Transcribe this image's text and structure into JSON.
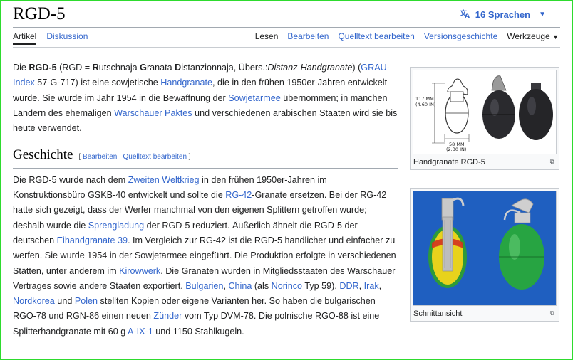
{
  "page": {
    "title": "RGD-5",
    "languages_label": "16 Sprachen",
    "tabs_left": [
      "Artikel",
      "Diskussion"
    ],
    "tabs_right": [
      "Lesen",
      "Bearbeiten",
      "Quelltext bearbeiten",
      "Versionsgeschichte",
      "Werkzeuge"
    ]
  },
  "intro": [
    {
      "t": "Die "
    },
    {
      "t": "RGD-5",
      "b": 1
    },
    {
      "t": " (RGD = "
    },
    {
      "t": "R",
      "b": 1
    },
    {
      "t": "utschnaja "
    },
    {
      "t": "G",
      "b": 1
    },
    {
      "t": "ranata "
    },
    {
      "t": "D",
      "b": 1
    },
    {
      "t": "istanzionnaja, Übers.:"
    },
    {
      "t": "Distanz-Handgranate",
      "i": 1
    },
    {
      "t": ") ("
    },
    {
      "t": "GRAU-Index",
      "l": 1
    },
    {
      "t": " 57-G-717) ist eine sowjetische "
    },
    {
      "t": "Handgranate",
      "l": 1
    },
    {
      "t": ", die in den frühen 1950er-Jahren entwickelt wurde. Sie wurde im Jahr 1954 in die Bewaffnung der "
    },
    {
      "t": "Sowjetarmee",
      "l": 1
    },
    {
      "t": " übernommen; in manchen Ländern des ehemaligen "
    },
    {
      "t": "Warschauer Paktes",
      "l": 1
    },
    {
      "t": " und verschiedenen arabischen Staaten wird sie bis heute verwendet."
    }
  ],
  "section": {
    "heading": "Geschichte",
    "edit_open": "[ ",
    "edit_link1": "Bearbeiten",
    "edit_sep": " | ",
    "edit_link2": "Quelltext bearbeiten",
    "edit_close": " ]"
  },
  "history": [
    {
      "t": "Die RGD-5 wurde nach dem "
    },
    {
      "t": "Zweiten Weltkrieg",
      "l": 1
    },
    {
      "t": " in den frühen 1950er-Jahren im Konstruktionsbüro GSKB-40 entwickelt und sollte die "
    },
    {
      "t": "RG-42",
      "l": 1
    },
    {
      "t": "-Granate ersetzen. Bei der RG-42 hatte sich gezeigt, dass der Werfer manchmal von den eigenen Splittern getroffen wurde; deshalb wurde die "
    },
    {
      "t": "Sprengladung",
      "l": 1
    },
    {
      "t": " der RGD-5 reduziert. Äußerlich ähnelt die RGD-5 der deutschen "
    },
    {
      "t": "Eihandgranate 39",
      "l": 1
    },
    {
      "t": ". Im Vergleich zur RG-42 ist die RGD-5 handlicher und einfacher zu werfen. Sie wurde 1954 in der Sowjetarmee eingeführt. Die Produktion erfolgte in verschiedenen Stätten, unter anderem im "
    },
    {
      "t": "Kirowwerk",
      "l": 1
    },
    {
      "t": ". Die Granaten wurden in Mitgliedsstaaten des Warschauer Vertrages sowie andere Staaten exportiert. "
    },
    {
      "t": "Bulgarien",
      "l": 1
    },
    {
      "t": ", "
    },
    {
      "t": "China",
      "l": 1
    },
    {
      "t": " (als "
    },
    {
      "t": "Norinco",
      "l": 1
    },
    {
      "t": " Typ 59), "
    },
    {
      "t": "DDR",
      "l": 1
    },
    {
      "t": ", "
    },
    {
      "t": "Irak",
      "l": 1
    },
    {
      "t": ", "
    },
    {
      "t": "Nordkorea",
      "l": 1
    },
    {
      "t": " und "
    },
    {
      "t": "Polen",
      "l": 1
    },
    {
      "t": " stellten Kopien oder eigene Varianten her. So haben die bulgarischen RGO-78 und RGN-86 einen neuen "
    },
    {
      "t": "Zünder",
      "l": 1
    },
    {
      "t": " vom Typ DVM-78. Die polnische RGO-88 ist eine Splitterhandgranate mit 60 g "
    },
    {
      "t": "A-IX-1",
      "l": 1
    },
    {
      "t": " und 1150 Stahlkugeln."
    }
  ],
  "figure1": {
    "caption": "Handgranate RGD-5",
    "dim_height": "117 MM",
    "dim_height_in": "(4.60 IN)",
    "dim_width": "58 MM",
    "dim_width_in": "(2.30 IN)"
  },
  "figure2": {
    "caption": "Schnittansicht"
  },
  "colors": {
    "link": "#3366cc",
    "frame": "#2edb2e",
    "photo_bg": "#1f5fc0",
    "grenade_green": "#2d9a3a",
    "explosive_yellow": "#e8d21c",
    "cut_red": "#d3311f"
  }
}
